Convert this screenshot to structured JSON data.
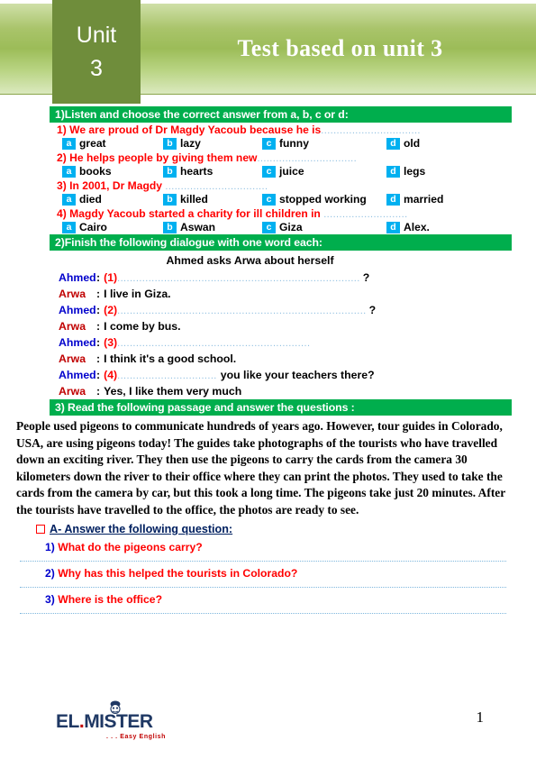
{
  "header": {
    "unit_label": "Unit",
    "unit_number": "3",
    "title": "Test based on unit 3",
    "banner_color": "#9cbc58",
    "unit_box_color": "#6f8d3b"
  },
  "section1": {
    "bar": "1)Listen and choose the correct answer from a, b, c or d:",
    "bar_color": "#00ae4d",
    "badge_color": "#00b0f0",
    "question_color": "#ff0000",
    "questions": [
      {
        "number": "1)",
        "text": "We are proud of Dr Magdy Yacoub because he is",
        "dots": "................................",
        "options": [
          {
            "letter": "a",
            "text": "great"
          },
          {
            "letter": "b",
            "text": "lazy"
          },
          {
            "letter": "c",
            "text": "funny"
          },
          {
            "letter": "d",
            "text": "old"
          }
        ]
      },
      {
        "number": "2)",
        "text": "He helps people by giving them new",
        "dots": "................................",
        "options": [
          {
            "letter": "a",
            "text": "books"
          },
          {
            "letter": "b",
            "text": "hearts"
          },
          {
            "letter": "c",
            "text": "juice"
          },
          {
            "letter": "d",
            "text": "legs"
          }
        ]
      },
      {
        "number": "3)",
        "text": "In 2001, Dr Magdy",
        "dots": ".................................",
        "options": [
          {
            "letter": "a",
            "text": "died"
          },
          {
            "letter": "b",
            "text": "killed"
          },
          {
            "letter": "c",
            "text": "stopped working"
          },
          {
            "letter": "d",
            "text": "married"
          }
        ]
      },
      {
        "number": "4)",
        "text": "Magdy Yacoub started a charity for ill children in",
        "dots": "...........................",
        "options": [
          {
            "letter": "a",
            "text": "Cairo"
          },
          {
            "letter": "b",
            "text": "Aswan"
          },
          {
            "letter": "c",
            "text": "Giza"
          },
          {
            "letter": "d",
            "text": "Alex."
          }
        ]
      }
    ]
  },
  "section2": {
    "bar": "2)Finish the following dialogue with one word each:",
    "title": "Ahmed asks Arwa about herself",
    "rows": [
      {
        "speaker": "Ahmed",
        "type": "blank",
        "num": "(1)",
        "dots": "..............................................................................",
        "tail": "",
        "qmark": "?"
      },
      {
        "speaker": "Arwa",
        "type": "text",
        "text": "I live in Giza."
      },
      {
        "speaker": "Ahmed",
        "type": "blank",
        "num": "(2)",
        "dots": "................................................................................",
        "tail": "",
        "qmark": "?"
      },
      {
        "speaker": "Arwa",
        "type": "text",
        "text": "I come by bus."
      },
      {
        "speaker": "Ahmed",
        "type": "blank",
        "num": "(3)",
        "dots": "..............................................................",
        "tail": "",
        "qmark": ""
      },
      {
        "speaker": "Arwa",
        "type": "text",
        "text": "I think it's a good school."
      },
      {
        "speaker": "Ahmed",
        "type": "blank",
        "num": "(4)",
        "dots": "................................",
        "tail": "you like your teachers there?",
        "qmark": ""
      },
      {
        "speaker": "Arwa",
        "type": "text",
        "text": "Yes, I like them very much"
      }
    ]
  },
  "section3": {
    "bar": "3) Read the following passage and answer the questions :",
    "passage": "People used pigeons to communicate hundreds of years ago. However, tour guides in Colorado, USA, are using pigeons today! The guides take photographs of the tourists who have travelled down an exciting river. They then use the pigeons to carry the cards from the camera 30 kilometers down the river to their office where they can print the photos. They used to take the cards from the camera by car, but this took a long time. The pigeons take just 20 minutes. After the tourists have travelled to the office, the photos are ready to see.",
    "answer_heading": "A- Answer the following question:",
    "questions": [
      {
        "number": "1)",
        "text": "What do the pigeons carry?"
      },
      {
        "number": "2)",
        "text": "Why has this helped the tourists in Colorado?"
      },
      {
        "number": "3)",
        "text": "Where is the office?"
      }
    ]
  },
  "footer": {
    "logo_part1": "EL",
    "logo_dot": ".",
    "logo_part2": "MISTER",
    "tagline": ". . . Easy English",
    "page_number": "1",
    "logo_color": "#1f3864",
    "tagline_color": "#c00000"
  }
}
